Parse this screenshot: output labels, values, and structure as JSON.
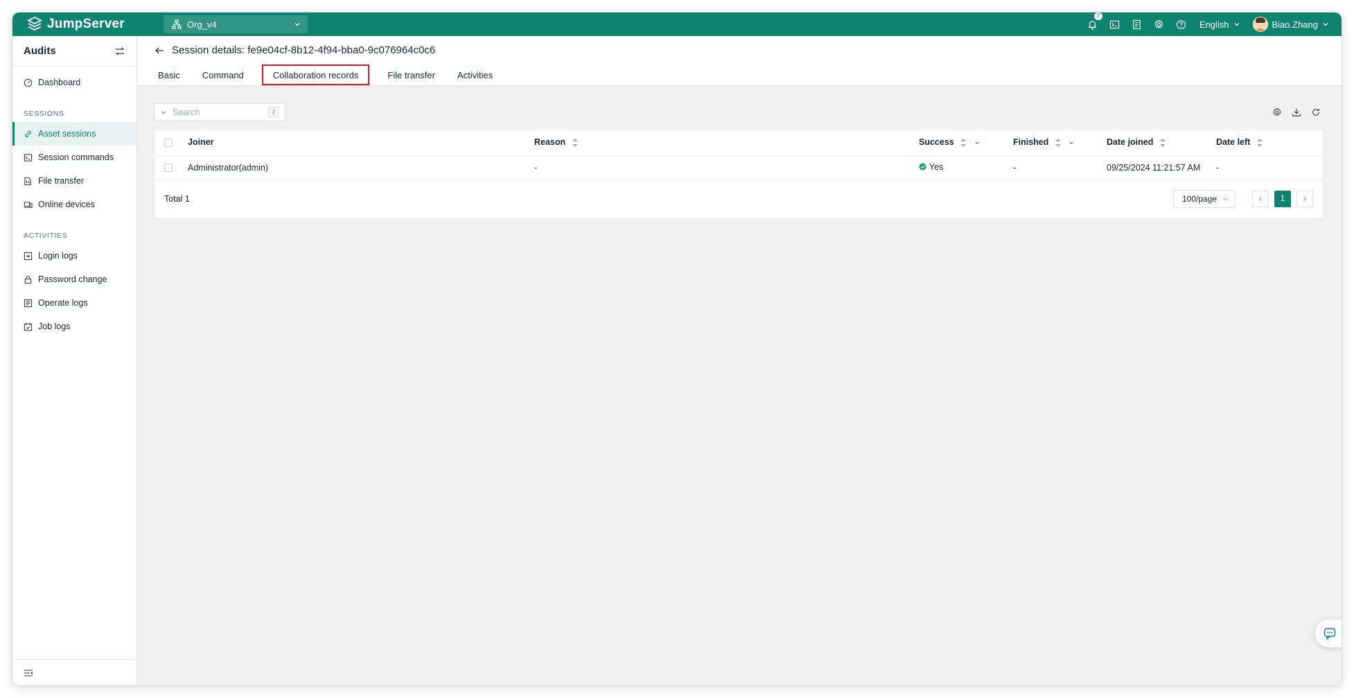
{
  "brand": {
    "name": "JumpServer"
  },
  "org": {
    "name": "Org_v4"
  },
  "topbar": {
    "notification_count": "7",
    "language": "English",
    "username": "Biao.Zhang"
  },
  "sidebar": {
    "title": "Audits",
    "items": [
      {
        "label": "Dashboard",
        "icon": "dashboard-icon"
      }
    ],
    "sections": [
      {
        "title": "SESSIONS",
        "items": [
          {
            "label": "Asset sessions",
            "icon": "link-icon",
            "active": true
          },
          {
            "label": "Session commands",
            "icon": "terminal-icon"
          },
          {
            "label": "File transfer",
            "icon": "file-transfer-icon"
          },
          {
            "label": "Online devices",
            "icon": "devices-icon"
          }
        ]
      },
      {
        "title": "ACTIVITIES",
        "items": [
          {
            "label": "Login logs",
            "icon": "login-icon"
          },
          {
            "label": "Password change",
            "icon": "lock-icon"
          },
          {
            "label": "Operate logs",
            "icon": "list-icon"
          },
          {
            "label": "Job logs",
            "icon": "calendar-check-icon"
          }
        ]
      }
    ]
  },
  "page": {
    "title": "Session details: fe9e04cf-8b12-4f94-bba0-9c076964c0c6",
    "tabs": [
      "Basic",
      "Command",
      "Collaboration records",
      "File transfer",
      "Activities"
    ],
    "selected_tab": "Collaboration records"
  },
  "search": {
    "placeholder": "Search",
    "shortcut": "/"
  },
  "table": {
    "columns": [
      "Joiner",
      "Reason",
      "Success",
      "Finished",
      "Date joined",
      "Date left"
    ],
    "rows": [
      {
        "joiner": "Administrator(admin)",
        "reason": "-",
        "success": "Yes",
        "finished": "-",
        "date_joined": "09/25/2024 11:21:57 AM",
        "date_left": "-"
      }
    ]
  },
  "footer": {
    "total": "Total 1",
    "page_size": "100/page",
    "current_page": "1"
  },
  "colors": {
    "brand": "#0e8470",
    "highlight_box": "#e3161c",
    "success": "#1aa37a"
  }
}
